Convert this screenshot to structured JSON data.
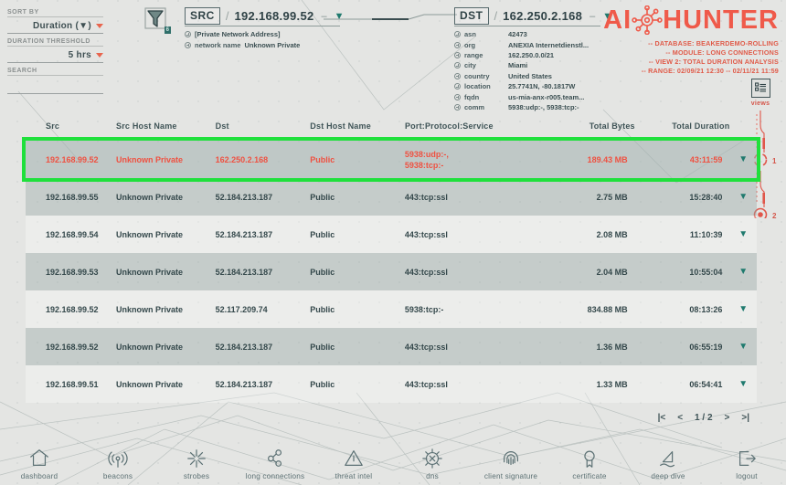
{
  "controls": {
    "sort_by_label": "SORT BY",
    "sort_by_value": "Duration (▼)",
    "threshold_label": "DURATION THRESHOLD",
    "threshold_value": "5 hrs",
    "search_label": "SEARCH",
    "search_value": "",
    "filter_badge": "6"
  },
  "src": {
    "tag": "SRC",
    "ip": "192.168.99.52",
    "dash": "–",
    "attrs": [
      {
        "key": "",
        "value": "[Private Network Address]"
      },
      {
        "key": "network name",
        "value": "Unknown Private"
      }
    ]
  },
  "dst": {
    "tag": "DST",
    "ip": "162.250.2.168",
    "dash": "–",
    "attrs": [
      {
        "key": "asn",
        "value": "42473"
      },
      {
        "key": "org",
        "value": "ANEXIA Internetdienstl..."
      },
      {
        "key": "range",
        "value": "162.250.0.0/21"
      },
      {
        "key": "city",
        "value": "Miami"
      },
      {
        "key": "country",
        "value": "United States"
      },
      {
        "key": "location",
        "value": "25.7741N, -80.1817W"
      },
      {
        "key": "fqdn",
        "value": "us-mia-anx-r005.team..."
      },
      {
        "key": "comm",
        "value": "5938:udp:-, 5938:tcp:-"
      }
    ]
  },
  "brand": {
    "text_left": "AI",
    "text_right": "HUNTER",
    "color": "#ef5a4a",
    "meta_lines": [
      "-- DATABASE: BEAKERDEMO-ROLLING",
      "-- MODULE: LONG CONNECTIONS",
      "-- VIEW 2: TOTAL DURATION ANALYSIS",
      "-- RANGE: 02/09/21 12:30 -- 02/11/21 11:59"
    ]
  },
  "views_rail": {
    "caption": "views",
    "markers": [
      "1",
      "2"
    ]
  },
  "table": {
    "headers": [
      "Src",
      "Src Host Name",
      "Dst",
      "Dst Host Name",
      "Port:Protocol:Service",
      "Total Bytes",
      "Total Duration"
    ],
    "rows": [
      {
        "src": "192.168.99.52",
        "src_host": "Unknown Private",
        "dst": "162.250.2.168",
        "dst_host": "Public",
        "service": "5938:udp:-,\n5938:tcp:-",
        "bytes": "189.43 MB",
        "duration": "43:11:59",
        "selected": true
      },
      {
        "src": "192.168.99.55",
        "src_host": "Unknown Private",
        "dst": "52.184.213.187",
        "dst_host": "Public",
        "service": "443:tcp:ssl",
        "bytes": "2.75 MB",
        "duration": "15:28:40",
        "selected": false
      },
      {
        "src": "192.168.99.54",
        "src_host": "Unknown Private",
        "dst": "52.184.213.187",
        "dst_host": "Public",
        "service": "443:tcp:ssl",
        "bytes": "2.08 MB",
        "duration": "11:10:39",
        "selected": false
      },
      {
        "src": "192.168.99.53",
        "src_host": "Unknown Private",
        "dst": "52.184.213.187",
        "dst_host": "Public",
        "service": "443:tcp:ssl",
        "bytes": "2.04 MB",
        "duration": "10:55:04",
        "selected": false
      },
      {
        "src": "192.168.99.52",
        "src_host": "Unknown Private",
        "dst": "52.117.209.74",
        "dst_host": "Public",
        "service": "5938:tcp:-",
        "bytes": "834.88 MB",
        "duration": "08:13:26",
        "selected": false
      },
      {
        "src": "192.168.99.52",
        "src_host": "Unknown Private",
        "dst": "52.184.213.187",
        "dst_host": "Public",
        "service": "443:tcp:ssl",
        "bytes": "1.36 MB",
        "duration": "06:55:19",
        "selected": false
      },
      {
        "src": "192.168.99.51",
        "src_host": "Unknown Private",
        "dst": "52.184.213.187",
        "dst_host": "Public",
        "service": "443:tcp:ssl",
        "bytes": "1.33 MB",
        "duration": "06:54:41",
        "selected": false
      }
    ]
  },
  "pagination": {
    "first": "|<",
    "prev": "<",
    "position": "1 / 2",
    "next": ">",
    "last": ">|"
  },
  "nav": [
    {
      "label": "dashboard",
      "icon": "home-icon"
    },
    {
      "label": "beacons",
      "icon": "broadcast-icon"
    },
    {
      "label": "strobes",
      "icon": "starburst-icon"
    },
    {
      "label": "long connections",
      "icon": "nodes-icon"
    },
    {
      "label": "threat intel",
      "icon": "warning-triangle-icon"
    },
    {
      "label": "dns",
      "icon": "compass-icon"
    },
    {
      "label": "client signature",
      "icon": "fingerprint-icon"
    },
    {
      "label": "certificate",
      "icon": "award-ribbon-icon"
    },
    {
      "label": "deep dive",
      "icon": "shark-fin-icon"
    },
    {
      "label": "logout",
      "icon": "exit-icon"
    }
  ]
}
